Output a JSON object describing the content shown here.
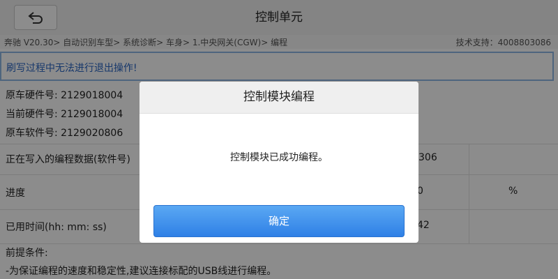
{
  "header": {
    "title": "控制单元",
    "back_icon": "back-arrow-icon"
  },
  "breadcrumb": "奔驰 V20.30> 自动识别车型> 系统诊断> 车身> 1.中央网关(CGW)> 编程",
  "support": "技术支持：4008803086",
  "warning": "刷写过程中无法进行退出操作!",
  "info_lines": [
    "原车硬件号: 2129018004",
    "当前硬件号: 2129018004",
    "原车软件号: 2129020806"
  ],
  "rows": {
    "writing": {
      "label": "正在写入的编程数据(软件号)",
      "value_partial": "306"
    },
    "progress": {
      "label": "进度",
      "value_partial": "0",
      "unit": "%"
    },
    "elapsed": {
      "label": "已用时间(hh: mm: ss)",
      "value_partial": "42"
    },
    "preconditions": {
      "label": "前提条件:",
      "line": "-为保证编程的速度和稳定性,建议连接标配的USB线进行编程。"
    }
  },
  "dialog": {
    "title": "控制模块编程",
    "message": "控制模块已成功编程。",
    "ok_label": "确定"
  },
  "colors": {
    "accent": "#2f80e6",
    "warning_text": "#2a66c4",
    "warning_border": "#8fb8e6"
  }
}
